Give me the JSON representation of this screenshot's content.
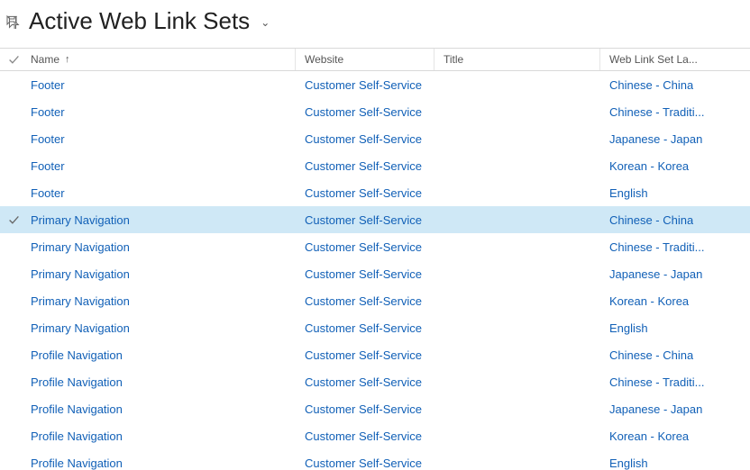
{
  "header": {
    "title": "Active Web Link Sets"
  },
  "columns": {
    "name": "Name",
    "website": "Website",
    "title": "Title",
    "language": "Web Link Set La..."
  },
  "sort_indicator": "↑",
  "rows": [
    {
      "name": "Footer",
      "website": "Customer Self-Service",
      "title": "",
      "language": "Chinese - China",
      "selected": false
    },
    {
      "name": "Footer",
      "website": "Customer Self-Service",
      "title": "",
      "language": "Chinese - Traditi...",
      "selected": false
    },
    {
      "name": "Footer",
      "website": "Customer Self-Service",
      "title": "",
      "language": "Japanese - Japan",
      "selected": false
    },
    {
      "name": "Footer",
      "website": "Customer Self-Service",
      "title": "",
      "language": "Korean - Korea",
      "selected": false
    },
    {
      "name": "Footer",
      "website": "Customer Self-Service",
      "title": "",
      "language": "English",
      "selected": false
    },
    {
      "name": "Primary Navigation",
      "website": "Customer Self-Service",
      "title": "",
      "language": "Chinese - China",
      "selected": true
    },
    {
      "name": "Primary Navigation",
      "website": "Customer Self-Service",
      "title": "",
      "language": "Chinese - Traditi...",
      "selected": false
    },
    {
      "name": "Primary Navigation",
      "website": "Customer Self-Service",
      "title": "",
      "language": "Japanese - Japan",
      "selected": false
    },
    {
      "name": "Primary Navigation",
      "website": "Customer Self-Service",
      "title": "",
      "language": "Korean - Korea",
      "selected": false
    },
    {
      "name": "Primary Navigation",
      "website": "Customer Self-Service",
      "title": "",
      "language": "English",
      "selected": false
    },
    {
      "name": "Profile Navigation",
      "website": "Customer Self-Service",
      "title": "",
      "language": "Chinese - China",
      "selected": false
    },
    {
      "name": "Profile Navigation",
      "website": "Customer Self-Service",
      "title": "",
      "language": "Chinese - Traditi...",
      "selected": false
    },
    {
      "name": "Profile Navigation",
      "website": "Customer Self-Service",
      "title": "",
      "language": "Japanese - Japan",
      "selected": false
    },
    {
      "name": "Profile Navigation",
      "website": "Customer Self-Service",
      "title": "",
      "language": "Korean - Korea",
      "selected": false
    },
    {
      "name": "Profile Navigation",
      "website": "Customer Self-Service",
      "title": "",
      "language": "English",
      "selected": false
    }
  ]
}
